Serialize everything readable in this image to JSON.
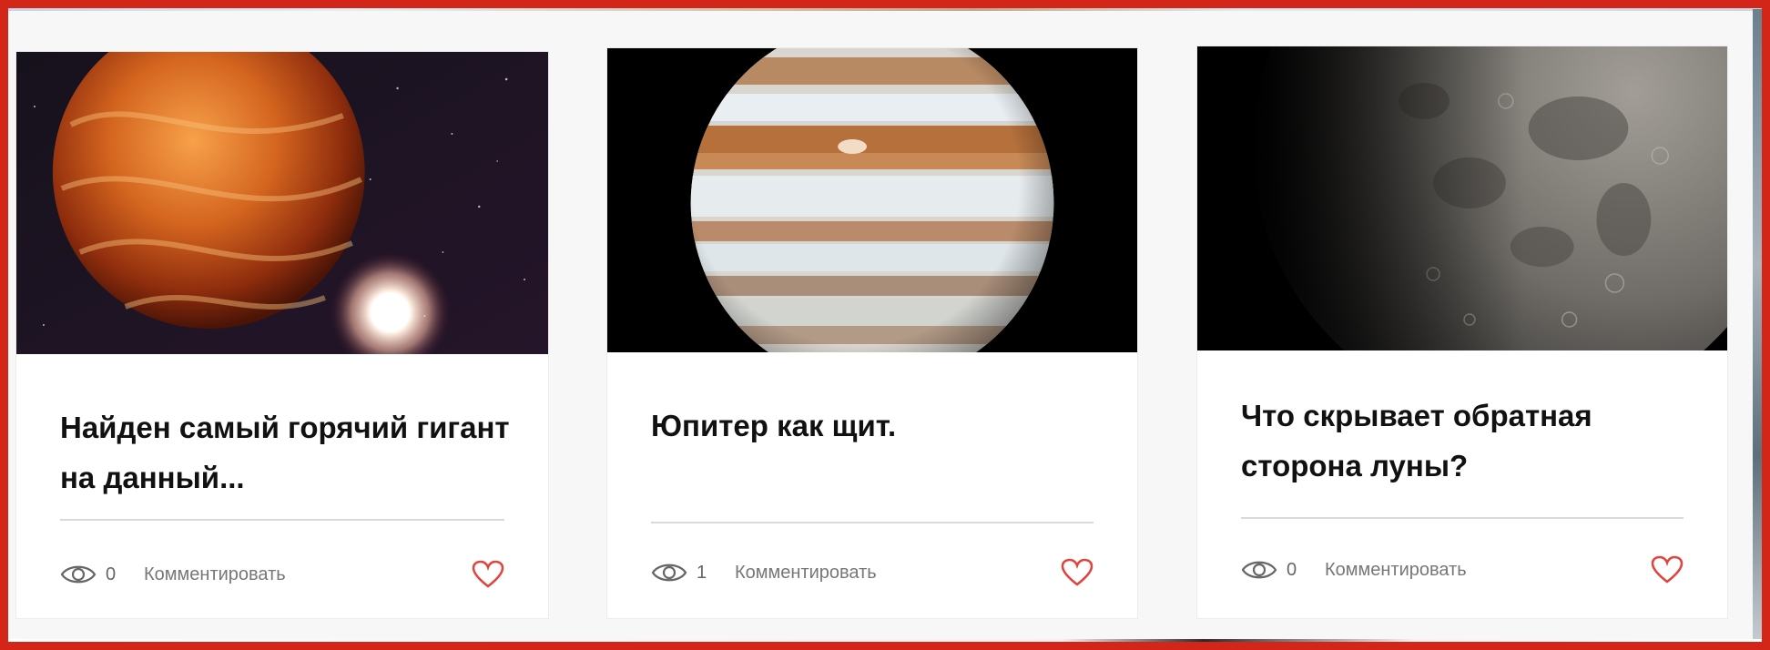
{
  "cards": [
    {
      "title": "Найден самый горячий гигант на данный...",
      "views": "0",
      "comment_label": "Комментировать",
      "image_subject": "hot-gas-giant-with-star"
    },
    {
      "title": "Юпитер как щит.",
      "views": "1",
      "comment_label": "Комментировать",
      "image_subject": "jupiter"
    },
    {
      "title": "Что скрывает обратная сторона луны?",
      "views": "0",
      "comment_label": "Комментировать",
      "image_subject": "moon"
    }
  ],
  "colors": {
    "frame_accent": "#d42618",
    "heart": "#e0443e",
    "title_text": "#111111",
    "meta_text": "#777777"
  },
  "icons": {
    "views": "eye-icon",
    "like": "heart-icon"
  }
}
